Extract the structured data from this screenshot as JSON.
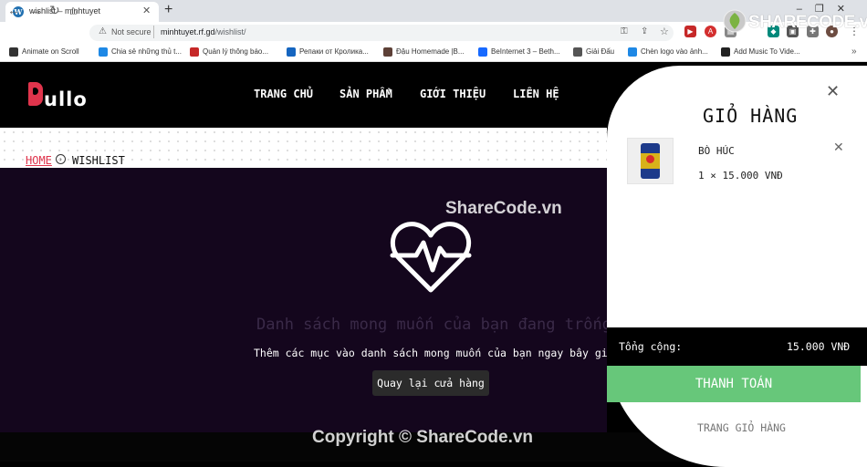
{
  "browser": {
    "tab_title": "wishlist – minhtuyet",
    "tab_favicon": "W",
    "tab_close": "✕",
    "new_tab": "+",
    "window_controls": "–❐✕",
    "insecure_label": "Not secure",
    "url_host": "minhtuyet.rf.gd",
    "url_path": "/wishlist/",
    "bookmarks": [
      {
        "label": "Animate on Scroll",
        "icon": "github-icon",
        "color": "#333333"
      },
      {
        "label": "Chia sẻ những thủ t...",
        "icon": "bolt-icon",
        "color": "#1e88e5"
      },
      {
        "label": "Quản lý thông báo...",
        "icon": "w-icon",
        "color": "#c62828"
      },
      {
        "label": "Репаки от Кролика...",
        "icon": "rabbit-icon",
        "color": "#1565c0"
      },
      {
        "label": "Đậu Homemade |B...",
        "icon": "photo-icon",
        "color": "#5d4037"
      },
      {
        "label": "BeInternet 3 – Beth...",
        "icon": "be-icon",
        "color": "#1769ff"
      },
      {
        "label": "Giải Đấu",
        "icon": "globe-icon",
        "color": "#555555"
      },
      {
        "label": "Chèn logo vào ảnh...",
        "icon": "b-icon",
        "color": "#1e88e5"
      },
      {
        "label": "Add Music To Vide...",
        "icon": "v2-icon",
        "color": "#222222"
      }
    ]
  },
  "watermark": {
    "logo_text": "SHARECODE.vn",
    "center_text": "ShareCode.vn",
    "copyright": "Copyright © ShareCode.vn"
  },
  "site": {
    "logo_text": "ullo",
    "nav": [
      "TRANG CHỦ",
      "SẢN PHẨM",
      "GIỚI THIỆU",
      "LIÊN HỆ"
    ],
    "breadcrumb": {
      "home": "HOME",
      "separator": "›",
      "current": "WISHLIST"
    },
    "wishlist": {
      "empty_title": "Danh sách mong muốn của bạn đang trống",
      "empty_subtitle": "Thêm các mục vào danh sách mong muốn của bạn ngay bây giờ!",
      "back_button": "Quay lại cửa hàng"
    }
  },
  "cart": {
    "close": "✕",
    "title": "GIỎ HÀNG",
    "items": [
      {
        "name": "BÒ HÚC",
        "quantity_price": "1 × 15.000 VNĐ",
        "remove": "✕"
      }
    ],
    "total_label": "Tổng cộng:",
    "total_value": "15.000 VNĐ",
    "checkout_label": "THANH TOÁN",
    "view_cart_label": "TRANG GIỎ HÀNG"
  },
  "colors": {
    "brand_red": "#e0344c",
    "wishlist_bg": "#14061d",
    "checkout_green": "#67c77a"
  }
}
